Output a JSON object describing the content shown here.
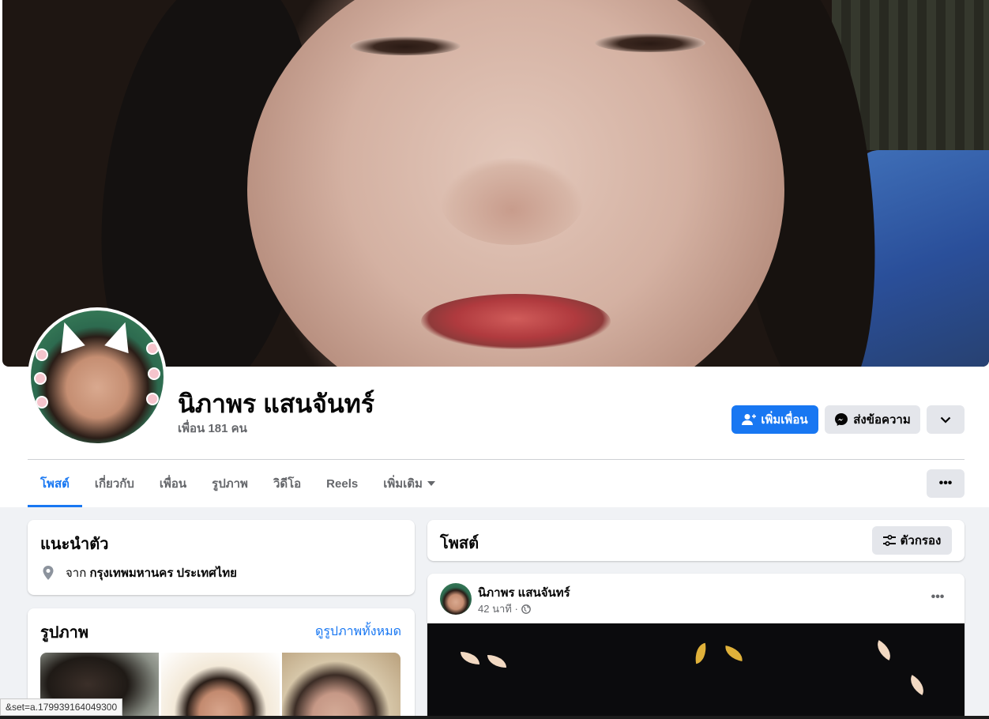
{
  "profile": {
    "name": "นิภาพร แสนจันทร์",
    "friends_count": "เพื่อน 181 คน"
  },
  "actions": {
    "add_friend": "เพิ่มเพื่อน",
    "message": "ส่งข้อความ"
  },
  "tabs": [
    {
      "label": "โพสต์",
      "active": true
    },
    {
      "label": "เกี่ยวกับ",
      "active": false
    },
    {
      "label": "เพื่อน",
      "active": false
    },
    {
      "label": "รูปภาพ",
      "active": false
    },
    {
      "label": "วิดีโอ",
      "active": false
    },
    {
      "label": "Reels",
      "active": false
    },
    {
      "label": "เพิ่มเติม",
      "active": false,
      "dropdown": true
    }
  ],
  "intro": {
    "title": "แนะนำตัว",
    "from_prefix": "จาก",
    "from_place": "กรุงเทพมหานคร ประเทศไทย"
  },
  "photos": {
    "title": "รูปภาพ",
    "see_all": "ดูรูปภาพทั้งหมด"
  },
  "posts": {
    "title": "โพสต์",
    "filter_label": "ตัวกรอง",
    "items": [
      {
        "author": "นิภาพร แสนจันทร์",
        "time": "42 นาที ·",
        "privacy_icon": "globe-icon"
      }
    ]
  },
  "status_url": "&set=a.179939164049300",
  "colors": {
    "accent": "#1877f2",
    "page_bg": "#f0f2f5",
    "secondary_button": "#e4e6eb",
    "muted_text": "#65676b"
  }
}
